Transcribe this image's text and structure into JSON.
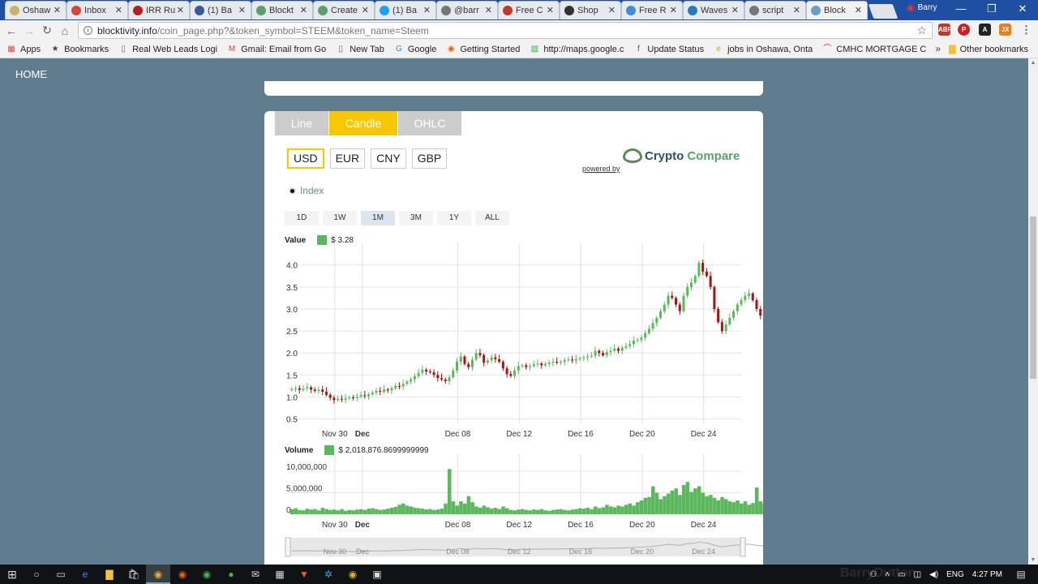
{
  "tabs": [
    {
      "label": "Oshaw",
      "color": "#c8b36a"
    },
    {
      "label": "Inbox",
      "color": "#d44638"
    },
    {
      "label": "IRR Ru",
      "color": "#b22222"
    },
    {
      "label": "(1) Ba",
      "color": "#3b5998"
    },
    {
      "label": "Blockt",
      "color": "#5aa06a"
    },
    {
      "label": "Create",
      "color": "#5aa06a"
    },
    {
      "label": "(1) Ba",
      "color": "#1da1f2"
    },
    {
      "label": "@barr",
      "color": "#777777"
    },
    {
      "label": "Free C",
      "color": "#c0392b"
    },
    {
      "label": "Shop",
      "color": "#333333"
    },
    {
      "label": "Free R",
      "color": "#3a8fd8"
    },
    {
      "label": "Waves",
      "color": "#2a7ab8"
    },
    {
      "label": "script",
      "color": "#777777"
    },
    {
      "label": "Block",
      "color": "#6aa0c8",
      "active": true
    }
  ],
  "profile_name": "Barry",
  "url": {
    "host": "blocktivity.info",
    "path": "/coin_page.php?&token_symbol=STEEM&token_name=Steem"
  },
  "bookmarks": [
    {
      "label": "Apps",
      "icon": "apps-icon"
    },
    {
      "label": "Bookmarks",
      "icon": "star-icon"
    },
    {
      "label": "Real Web Leads Logi",
      "icon": "page-icon"
    },
    {
      "label": "Gmail: Email from Go",
      "icon": "gmail-icon"
    },
    {
      "label": "New Tab",
      "icon": "page-icon"
    },
    {
      "label": "Google",
      "icon": "google-icon"
    },
    {
      "label": "Getting Started",
      "icon": "firefox-icon"
    },
    {
      "label": "http://maps.google.c",
      "icon": "maps-icon"
    },
    {
      "label": "Update Status",
      "icon": "facebook-icon"
    },
    {
      "label": "jobs in Oshawa, Onta",
      "icon": "e-icon"
    },
    {
      "label": "CMHC MORTGAGE C",
      "icon": "cmhc-icon"
    }
  ],
  "other_bookmarks": "Other bookmarks",
  "nav": {
    "home": "HOME"
  },
  "chart_tabs": [
    "Line",
    "Candle",
    "OHLC"
  ],
  "active_chart_tab": 1,
  "currencies": [
    "USD",
    "EUR",
    "CNY",
    "GBP"
  ],
  "active_currency": 0,
  "powered_by": "powered by",
  "logo": {
    "word1": "Crypto",
    "word2": "Compare"
  },
  "index_label": "Index",
  "ranges": [
    "1D",
    "1W",
    "1M",
    "3M",
    "1Y",
    "ALL"
  ],
  "active_range": 2,
  "value_legend": {
    "title": "Value",
    "value": "$ 3.28"
  },
  "volume_legend": {
    "title": "Volume",
    "value": "$ 2,018,876.8699999999"
  },
  "chart_data": {
    "type": "candlestick",
    "price_axis": {
      "ticks": [
        0.5,
        1.0,
        1.5,
        2.0,
        2.5,
        3.0,
        3.5,
        4.0
      ],
      "tick_labels": [
        "0.5",
        "1.0",
        "1.5",
        "2.0",
        "2.5",
        "3.0",
        "3.5",
        "4.0"
      ],
      "ylim": [
        0.4,
        4.4
      ]
    },
    "volume_axis": {
      "ticks": [
        0,
        5000000,
        10000000
      ],
      "tick_labels": [
        "0",
        "5,000,000",
        "10,000,000"
      ],
      "ylim": [
        0,
        13000000
      ]
    },
    "x_labels": [
      "Nov 30",
      "Dec",
      "Dec 08",
      "Dec 12",
      "Dec 16",
      "Dec 20",
      "Dec 24"
    ],
    "x_label_days": [
      3,
      4.8,
      11,
      15,
      19,
      23,
      27
    ],
    "x_range_days": [
      0,
      29.5
    ],
    "candle_step_days": 0.25,
    "closes": [
      1.18,
      1.2,
      1.16,
      1.19,
      1.22,
      1.17,
      1.14,
      1.17,
      1.12,
      1.05,
      0.98,
      0.93,
      0.96,
      0.94,
      0.97,
      0.99,
      0.98,
      1.01,
      1.04,
      1.02,
      1.06,
      1.1,
      1.14,
      1.12,
      1.17,
      1.15,
      1.2,
      1.25,
      1.24,
      1.3,
      1.35,
      1.4,
      1.47,
      1.55,
      1.62,
      1.58,
      1.56,
      1.5,
      1.43,
      1.4,
      1.36,
      1.45,
      1.6,
      1.8,
      1.92,
      1.75,
      1.68,
      1.85,
      2.0,
      1.95,
      1.78,
      1.83,
      1.9,
      1.86,
      1.8,
      1.65,
      1.52,
      1.48,
      1.6,
      1.7,
      1.72,
      1.68,
      1.7,
      1.74,
      1.76,
      1.72,
      1.75,
      1.78,
      1.8,
      1.78,
      1.8,
      1.84,
      1.85,
      1.83,
      1.86,
      1.88,
      1.9,
      1.92,
      1.94,
      2.05,
      2.0,
      1.95,
      2.02,
      2.05,
      2.1,
      2.05,
      2.12,
      2.16,
      2.2,
      2.28,
      2.3,
      2.35,
      2.45,
      2.55,
      2.68,
      2.8,
      2.95,
      3.1,
      3.3,
      3.25,
      3.1,
      2.95,
      3.3,
      3.5,
      3.6,
      3.75,
      4.05,
      3.85,
      3.75,
      3.5,
      3.0,
      2.7,
      2.5,
      2.65,
      2.8,
      2.95,
      3.1,
      3.2,
      3.3,
      3.35,
      3.2,
      3.0,
      2.85,
      3.0,
      3.15,
      3.25,
      3.2,
      3.28,
      3.3,
      3.35,
      3.3,
      3.4,
      3.45,
      3.35,
      3.2,
      3.28
    ],
    "volumes": [
      1200000,
      1400000,
      1000000,
      900000,
      1300000,
      1100000,
      1200000,
      900000,
      1500000,
      1200000,
      1000000,
      1100000,
      900000,
      1200000,
      800000,
      1000000,
      900000,
      1100000,
      1200000,
      1000000,
      1300000,
      1400000,
      1200000,
      1000000,
      1100000,
      1300000,
      1500000,
      1700000,
      2200000,
      2500000,
      2000000,
      1800000,
      1500000,
      1400000,
      1300000,
      1100000,
      1200000,
      1000000,
      1100000,
      1300000,
      2500000,
      10500000,
      3000000,
      2000000,
      3000000,
      2500000,
      4200000,
      2800000,
      1800000,
      1500000,
      2000000,
      1600000,
      1300000,
      1500000,
      1200000,
      1800000,
      1400000,
      1000000,
      900000,
      1100000,
      1200000,
      1000000,
      900000,
      1100000,
      1000000,
      1200000,
      900000,
      800000,
      1000000,
      1100000,
      1200000,
      1000000,
      900000,
      1100000,
      1200000,
      1400000,
      1300000,
      1500000,
      1200000,
      1800000,
      1400000,
      1600000,
      2200000,
      1800000,
      1600000,
      2000000,
      1800000,
      2200000,
      2500000,
      2000000,
      2800000,
      3200000,
      3800000,
      4000000,
      6500000,
      5000000,
      3500000,
      4200000,
      4800000,
      5500000,
      6000000,
      4500000,
      6800000,
      7500000,
      5200000,
      6000000,
      6500000,
      5000000,
      4200000,
      4500000,
      3800000,
      3200000,
      4000000,
      3500000,
      3000000,
      2800000,
      3200000,
      2500000,
      3000000,
      2200000,
      2600000,
      6200000,
      3000000,
      2400000,
      2800000,
      2200000,
      2000000,
      2500000,
      2400000,
      2800000,
      3000000,
      5200000,
      2800000,
      2000000
    ],
    "navigator_labels": [
      "Nov 30",
      "Dec",
      "Dec 08",
      "Dec 12",
      "Dec 16",
      "Dec 20",
      "Dec 24"
    ]
  },
  "colors": {
    "up": "#5cb85c",
    "down": "#a8120f",
    "accent": "#f7c800",
    "page_bg": "#5f7d8f"
  },
  "tray": {
    "lang": "ENG",
    "time": "4:27 PM"
  },
  "watermark": "BarryDutton"
}
